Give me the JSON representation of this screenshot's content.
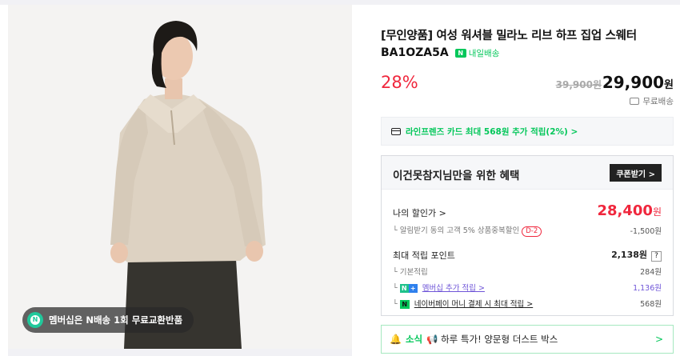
{
  "image": {
    "badge_text": "멤버십은 N배송 1회 무료교환반품",
    "badge_icon": "membership-icon"
  },
  "product": {
    "title": "[무인양품] 여성 워셔블 밀라노 리브 하프 집업 스웨터",
    "model": "BA1OZA5A",
    "delivery_label": "내일배송",
    "discount_rate": "28%",
    "original_price": "39,900원",
    "sale_price_number": "29,900",
    "sale_price_unit": "원",
    "shipping": "무료배송"
  },
  "card_promo": {
    "text": "라인프렌즈 카드 최대 568원 추가 적립(2%) >"
  },
  "benefit": {
    "title": "이건못참지님만을 위한 혜택",
    "coupon_button": "쿠폰받기 >",
    "my_discount_label": "나의 할인가 >",
    "my_price_number": "28,400",
    "my_price_unit": "원",
    "alert_discount_label": "알림받기 동의 고객 5% 상품중복할인",
    "alert_discount_badge": "D-2",
    "alert_discount_value": "-1,500원",
    "max_points_label": "최대 적립 포인트",
    "max_points_value": "2,138원",
    "help_symbol": "?",
    "basic_points_label": "기본적립",
    "basic_points_value": "284원",
    "membership_points_label": "멤버십 추가 적립 >",
    "membership_points_value": "1,136원",
    "npay_points_label": "네이버페이 머니 결제 시 최대 적립 >",
    "npay_points_value": "568원"
  },
  "news": {
    "label": "소식",
    "text": "📢 하루 특가! 양문형 더스트 박스",
    "chevron": ">"
  },
  "colors": {
    "accent_green": "#03c75a",
    "discount_red": "#f0273d",
    "link_purple": "#6f55d8"
  }
}
